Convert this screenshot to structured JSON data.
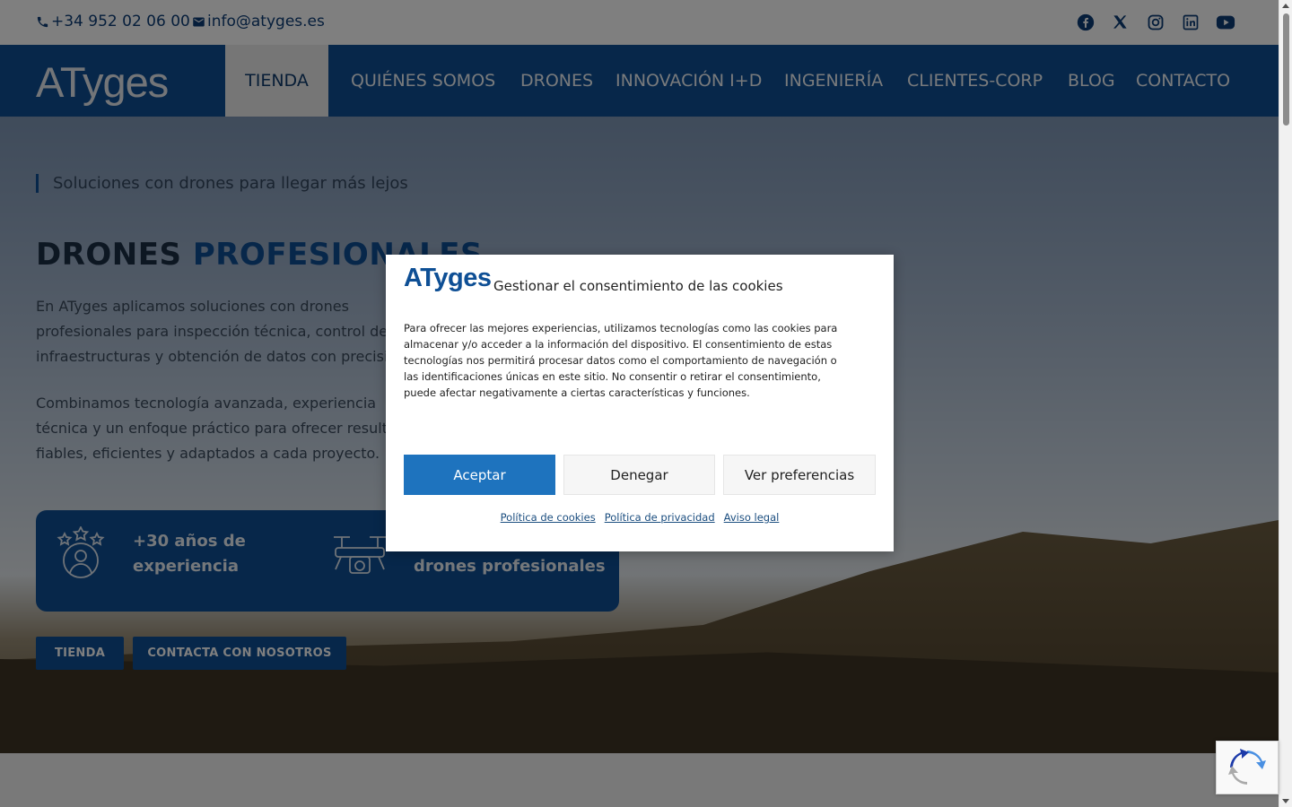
{
  "topbar": {
    "phone": "+34 952 02 06 00",
    "email": "info@atyges.es",
    "socials": [
      "facebook-icon",
      "x-icon",
      "instagram-icon",
      "linkedin-icon",
      "youtube-icon"
    ]
  },
  "nav": {
    "logo": "ATyges",
    "active": "TIENDA",
    "items": [
      "QUIÉNES SOMOS",
      "DRONES",
      "INNOVACIÓN I+D",
      "INGENIERÍA",
      "CLIENTES-CORP",
      "BLOG",
      "CONTACTO"
    ]
  },
  "hero": {
    "tagline": "Soluciones con drones para llegar más lejos",
    "title_part1": "DRONES",
    "title_part2": "PROFESIONALES",
    "paragraph1": "En ATyges aplicamos soluciones con drones profesionales para inspección técnica, control de infraestructuras y obtención de datos con precisión.",
    "paragraph2": "Combinamos tecnología avanzada, experiencia técnica y un enfoque práctico para ofrecer resultados fiables, eficientes y adaptados a cada proyecto.",
    "feature1": "+30 años de experiencia",
    "feature2": "drones profesionales",
    "button1": "TIENDA",
    "button2": "CONTACTA CON NOSOTROS"
  },
  "cookie": {
    "logo": "ATyges",
    "title": "Gestionar el consentimiento de las cookies",
    "body": "Para ofrecer las mejores experiencias, utilizamos tecnologías como las cookies para almacenar y/o acceder a la información del dispositivo. El consentimiento de estas tecnologías nos permitirá procesar datos como el comportamiento de navegación o las identificaciones únicas en este sitio. No consentir o retirar el consentimiento, puede afectar negativamente a ciertas características y funciones.",
    "accept": "Aceptar",
    "deny": "Denegar",
    "preferences": "Ver preferencias",
    "links": [
      "Política de cookies",
      "Política de privacidad",
      "Aviso legal"
    ]
  },
  "colors": {
    "brand": "#0e4f95",
    "accept": "#1e73be"
  }
}
